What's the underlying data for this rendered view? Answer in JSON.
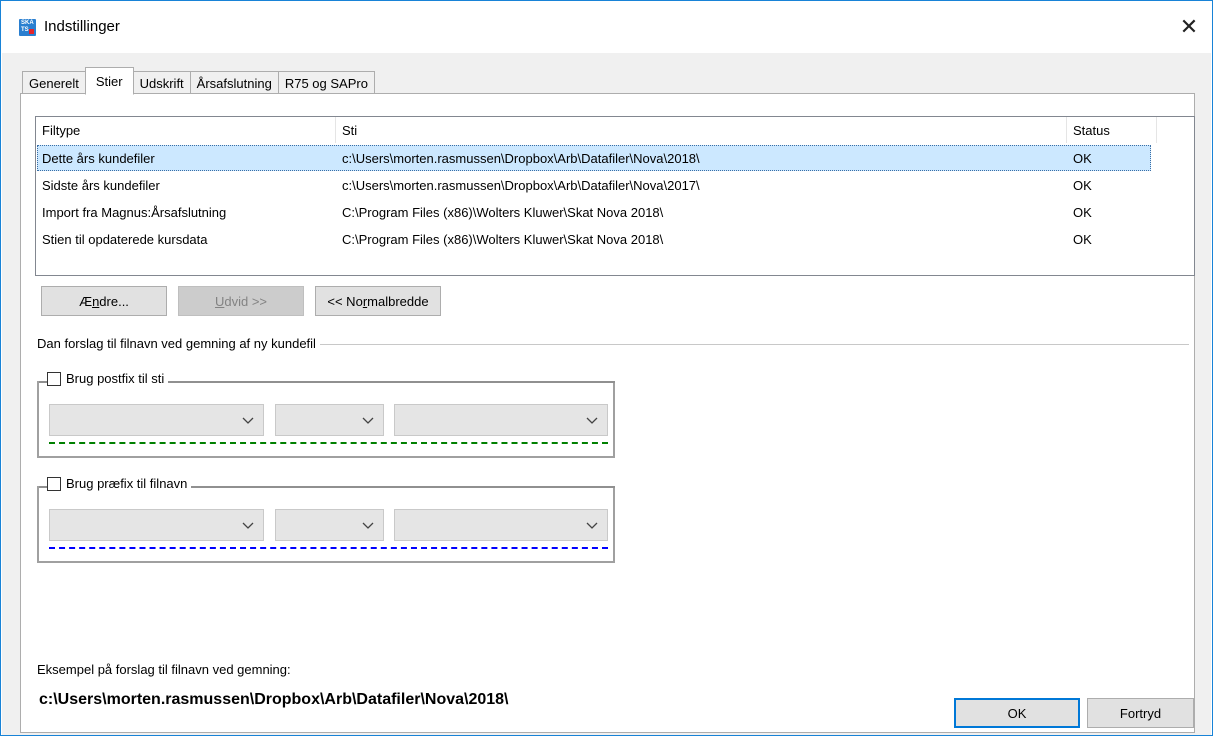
{
  "window": {
    "title": "Indstillinger",
    "icon_top": "SKA",
    "icon_bottom": "TS",
    "close": "✕"
  },
  "tabs": [
    {
      "label": "Generelt"
    },
    {
      "label": "Stier"
    },
    {
      "label": "Udskrift"
    },
    {
      "label": "Årsafslutning"
    },
    {
      "label": "R75 og SAPro"
    }
  ],
  "table": {
    "columns": [
      "Filtype",
      "Sti",
      "Status"
    ],
    "rows": [
      {
        "filtype": "Dette års kundefiler",
        "sti": "c:\\Users\\morten.rasmussen\\Dropbox\\Arb\\Datafiler\\Nova\\2018\\",
        "status": "OK"
      },
      {
        "filtype": "Sidste års kundefiler",
        "sti": "c:\\Users\\morten.rasmussen\\Dropbox\\Arb\\Datafiler\\Nova\\2017\\",
        "status": "OK"
      },
      {
        "filtype": "Import fra Magnus:Årsafslutning",
        "sti": "C:\\Program Files (x86)\\Wolters Kluwer\\Skat Nova 2018\\",
        "status": "OK"
      },
      {
        "filtype": "Stien til opdaterede kursdata",
        "sti": "C:\\Program Files (x86)\\Wolters Kluwer\\Skat Nova 2018\\",
        "status": "OK"
      }
    ]
  },
  "buttons": {
    "aendre": {
      "pre": "Æ",
      "u": "n",
      "post": "dre..."
    },
    "udvid": {
      "pre": "",
      "u": "U",
      "post": "dvid >>"
    },
    "normalbredde": {
      "pre": "<< No",
      "u": "r",
      "post": "malbredde"
    }
  },
  "group": {
    "label": "Dan forslag til filnavn ved gemning af ny kundefil",
    "postfix_label": "Brug postfix til sti",
    "prefix_label": "Brug præfix til filnavn"
  },
  "colors": {
    "postfix_dash": "#008000",
    "prefix_dash": "#0000ff",
    "selection": "#cce8ff"
  },
  "example": {
    "label": "Eksempel på forslag til filnavn ved gemning:",
    "value": "c:\\Users\\morten.rasmussen\\Dropbox\\Arb\\Datafiler\\Nova\\2018\\"
  },
  "footer": {
    "ok": "OK",
    "cancel": "Fortryd"
  }
}
